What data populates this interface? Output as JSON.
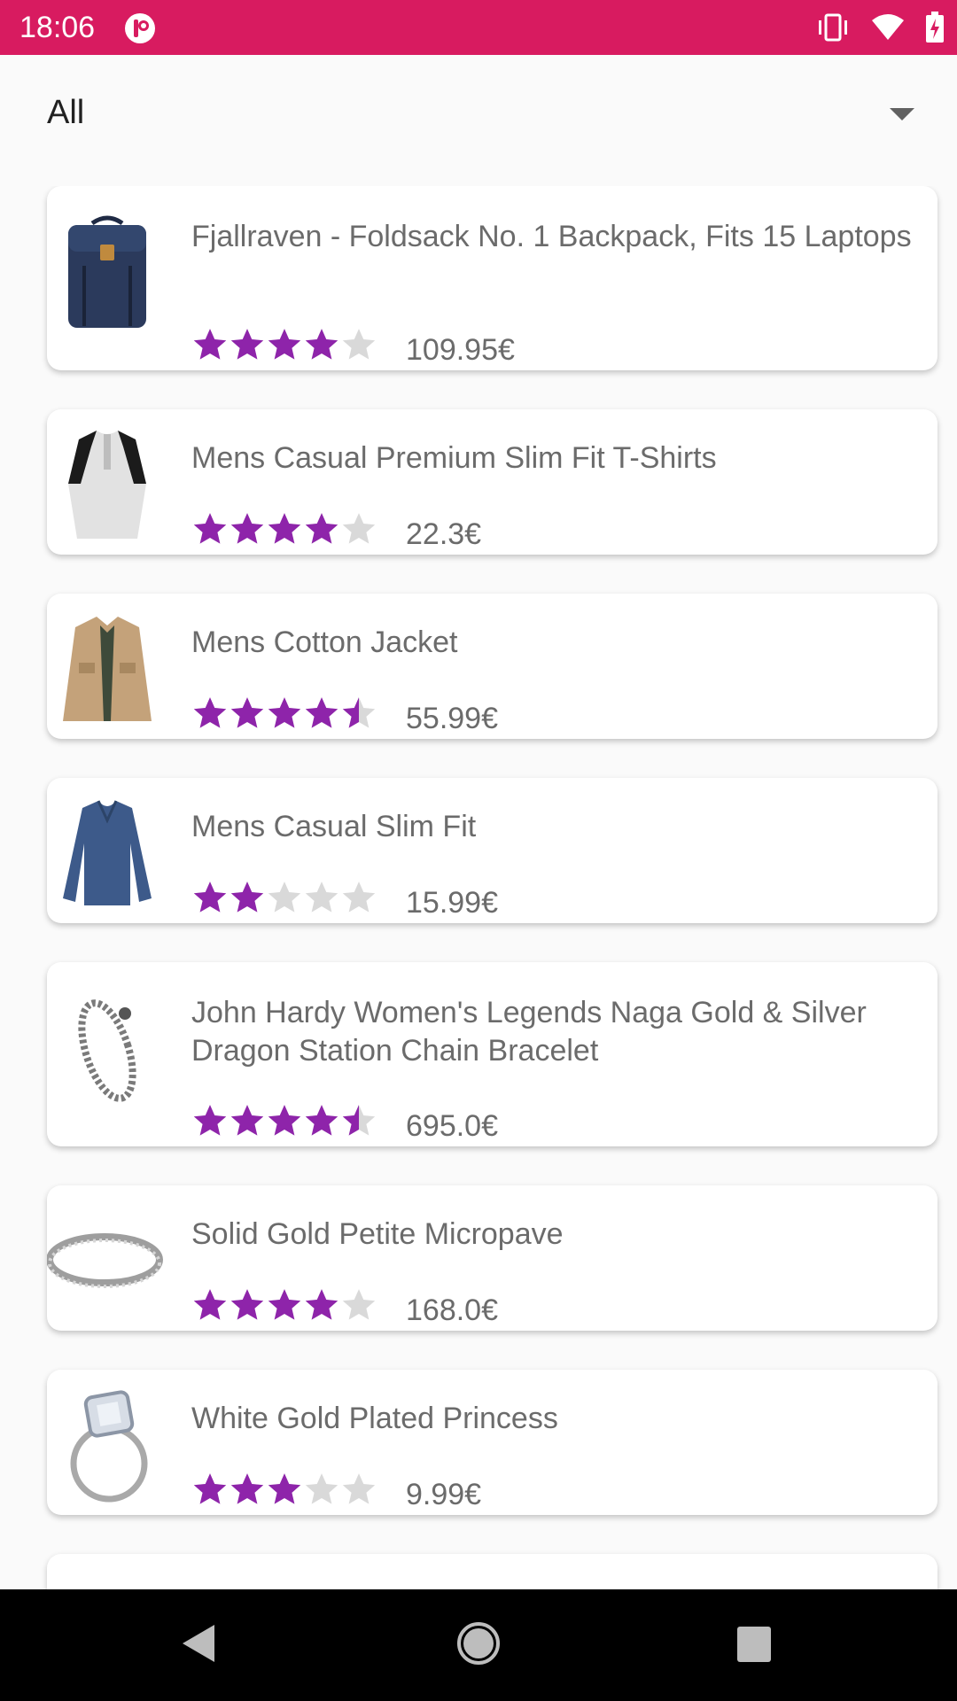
{
  "status_bar": {
    "time": "18:06",
    "background": "#d81b60"
  },
  "filter": {
    "selected": "All",
    "icon": "arrow-drop-down-icon"
  },
  "colors": {
    "star_filled": "#8e24aa",
    "star_empty": "#d9d9d9",
    "text": "#6b6b6b"
  },
  "products": [
    {
      "title": "Fjallraven - Foldsack No. 1 Backpack, Fits 15 Laptops",
      "price": "109.95€",
      "rating": 4.0,
      "thumb": "backpack-image"
    },
    {
      "title": "Mens Casual Premium Slim Fit T-Shirts",
      "price": "22.3€",
      "rating": 4.0,
      "thumb": "tshirt-image"
    },
    {
      "title": "Mens Cotton Jacket",
      "price": "55.99€",
      "rating": 4.5,
      "thumb": "jacket-image"
    },
    {
      "title": "Mens Casual Slim Fit",
      "price": "15.99€",
      "rating": 2.0,
      "thumb": "longsleeve-image"
    },
    {
      "title": "John Hardy Women's Legends Naga Gold & Silver Dragon Station Chain Bracelet",
      "price": "695.0€",
      "rating": 4.5,
      "thumb": "bracelet-image"
    },
    {
      "title": "Solid Gold Petite Micropave",
      "price": "168.0€",
      "rating": 4.0,
      "thumb": "ring-image"
    },
    {
      "title": "White Gold Plated Princess",
      "price": "9.99€",
      "rating": 3.0,
      "thumb": "princess-ring-image"
    }
  ],
  "nav": {
    "back": "back-icon",
    "home": "home-icon",
    "recents": "recents-icon"
  }
}
